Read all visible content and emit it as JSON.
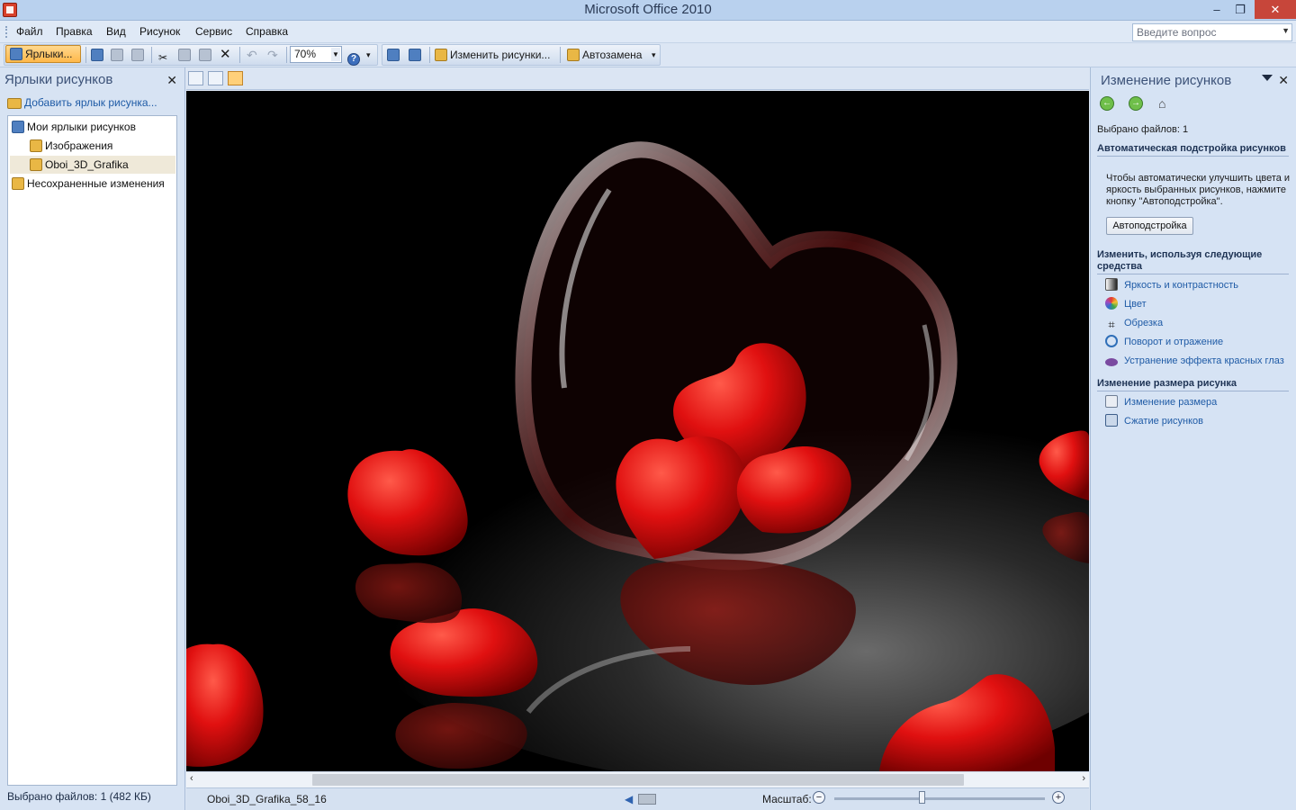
{
  "window": {
    "title": "Microsoft Office 2010",
    "buttons": {
      "minimize": "‒",
      "restore": "❐",
      "close": "✕"
    }
  },
  "menu": {
    "items": [
      {
        "label": "Файл"
      },
      {
        "label": "Правка"
      },
      {
        "label": "Вид"
      },
      {
        "label": "Рисунок"
      },
      {
        "label": "Сервис"
      },
      {
        "label": "Справка"
      }
    ],
    "question_placeholder": "Введите вопрос"
  },
  "toolbar": {
    "shortcuts_label": "Ярлыки...",
    "zoom_value": "70%",
    "edit_pictures_label": "Изменить рисунки...",
    "autocorrect_label": "Автозамена",
    "help_glyph": "?"
  },
  "left_pane": {
    "title": "Ярлыки рисунков",
    "add_shortcut": "Добавить ярлык рисунка...",
    "tree": [
      {
        "label": "Мои ярлыки рисунков",
        "icon": "picture-shortcuts-icon"
      },
      {
        "label": "Изображения",
        "icon": "folder-icon"
      },
      {
        "label": "Oboi_3D_Grafika",
        "icon": "folder-icon",
        "selected": true
      },
      {
        "label": "Несохраненные изменения",
        "icon": "unsaved-icon"
      }
    ],
    "status": "Выбрано файлов: 1 (482 КБ)"
  },
  "viewer": {
    "filename": "Oboi_3D_Grafika_58_16",
    "zoom_label": "Масштаб:",
    "zoom_level": 0.42
  },
  "right_pane": {
    "title": "Изменение рисунков",
    "selected_files": "Выбрано файлов: 1",
    "auto_section": "Автоматическая подстройка рисунков",
    "auto_desc": "Чтобы автоматически улучшить цвета и яркость выбранных рисунков, нажмите кнопку \"Автоподстройка\".",
    "auto_button": "Автоподстройка",
    "tools_section": "Изменить, используя следующие средства",
    "tools": [
      {
        "label": "Яркость и контрастность",
        "icon": "brightness-icon",
        "color": "#555555"
      },
      {
        "label": "Цвет",
        "icon": "color-wheel-icon",
        "color": "#d04b3a"
      },
      {
        "label": "Обрезка",
        "icon": "crop-icon",
        "color": "#222222"
      },
      {
        "label": "Поворот и отражение",
        "icon": "rotate-icon",
        "color": "#2f6fb8"
      },
      {
        "label": "Устранение эффекта красных глаз",
        "icon": "red-eye-icon",
        "color": "#7a4aa0"
      }
    ],
    "resize_section": "Изменение размера рисунка",
    "resize_tools": [
      {
        "label": "Изменение размера",
        "icon": "resize-icon",
        "color": "#6f7f95"
      },
      {
        "label": "Сжатие рисунков",
        "icon": "compress-icon",
        "color": "#3e5f8a"
      }
    ]
  },
  "colors": {
    "accent": "#1f5ba6",
    "selection": "#ffc35a",
    "heart": "#d10e0e"
  }
}
